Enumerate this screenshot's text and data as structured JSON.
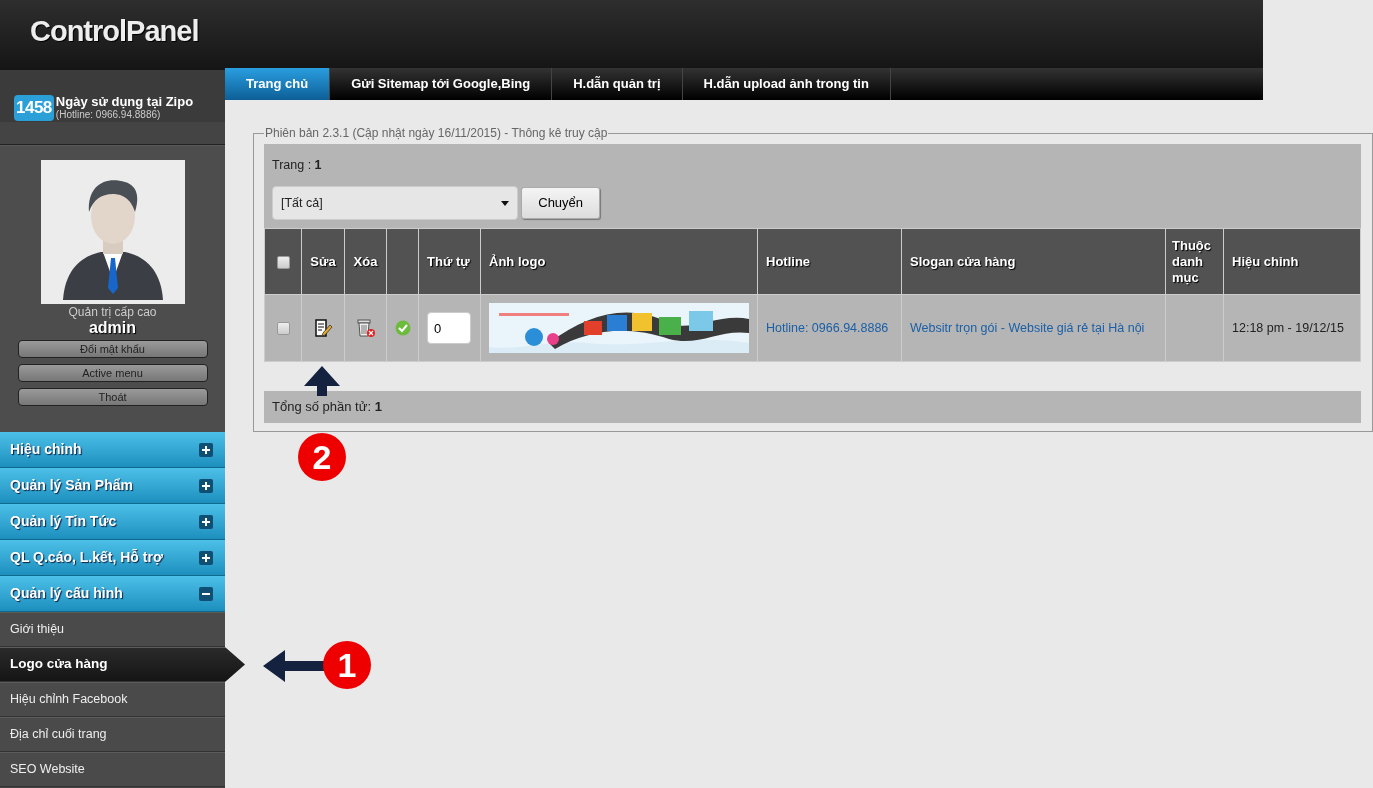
{
  "header": {
    "title": "ControlPanel"
  },
  "usage": {
    "count": "1458",
    "label": "Ngày sử dụng tại Zipo",
    "hotline": "(Hotline: 0966.94.8886)"
  },
  "profile": {
    "role": "Quản trị cấp cao",
    "username": "admin",
    "buttons": [
      "Đổi mật khẩu",
      "Active menu",
      "Thoát"
    ]
  },
  "menu": [
    {
      "label": "Hiệu chỉnh",
      "expanded": false
    },
    {
      "label": "Quản lý Sản Phẩm",
      "expanded": false
    },
    {
      "label": "Quản lý Tin Tức",
      "expanded": false
    },
    {
      "label": "QL Q.cáo, L.kết, Hỗ trợ",
      "expanded": false
    },
    {
      "label": "Quản lý cấu hình",
      "expanded": true,
      "children": [
        {
          "label": "Giới thiệu",
          "selected": false
        },
        {
          "label": "Logo cửa hàng",
          "selected": true
        },
        {
          "label": "Hiệu chỉnh Facebook",
          "selected": false
        },
        {
          "label": "Địa chỉ cuối trang",
          "selected": false
        },
        {
          "label": "SEO Website",
          "selected": false
        }
      ]
    }
  ],
  "tabs": [
    {
      "label": "Trang chủ",
      "selected": true
    },
    {
      "label": "Gửi Sitemap tới Google,Bing",
      "selected": false
    },
    {
      "label": "H.dẫn quản trị",
      "selected": false
    },
    {
      "label": "H.dẫn upload ảnh trong tin",
      "selected": false
    }
  ],
  "panel": {
    "legend": "Phiên bản 2.3.1 (Cập nhật ngày 16/11/2015) - Thông kê truy cập",
    "page_label": "Trang :",
    "page": "1",
    "filter": {
      "value": "[Tất cả]"
    },
    "go_button": "Chuyển",
    "columns": [
      {
        "kind": "checkbox",
        "checked": false
      },
      {
        "kind": "text",
        "label": "Sửa"
      },
      {
        "kind": "text",
        "label": "Xóa"
      },
      {
        "kind": "blank"
      },
      {
        "kind": "text",
        "label": "Thứ tự"
      },
      {
        "kind": "text",
        "label": "Ảnh logo"
      },
      {
        "kind": "text",
        "label": "Hotline"
      },
      {
        "kind": "text",
        "label": "Slogan cửa hàng"
      },
      {
        "kind": "text",
        "label": "Thuộc danh mục"
      },
      {
        "kind": "text",
        "label": "Hiệu chỉnh"
      }
    ],
    "rows": [
      {
        "checked": false,
        "approved": true,
        "order": "0",
        "hotline": "Hotline: 0966.94.8886",
        "slogan": "Websitr trọn gói - Website giá rẻ tại Hà nội",
        "edited": "12:18 pm - 19/12/15"
      }
    ],
    "total_label": "Tổng số phần tử:",
    "total": "1"
  },
  "annotations": [
    {
      "number": "1",
      "kind": "left"
    },
    {
      "number": "2",
      "kind": "up"
    }
  ]
}
